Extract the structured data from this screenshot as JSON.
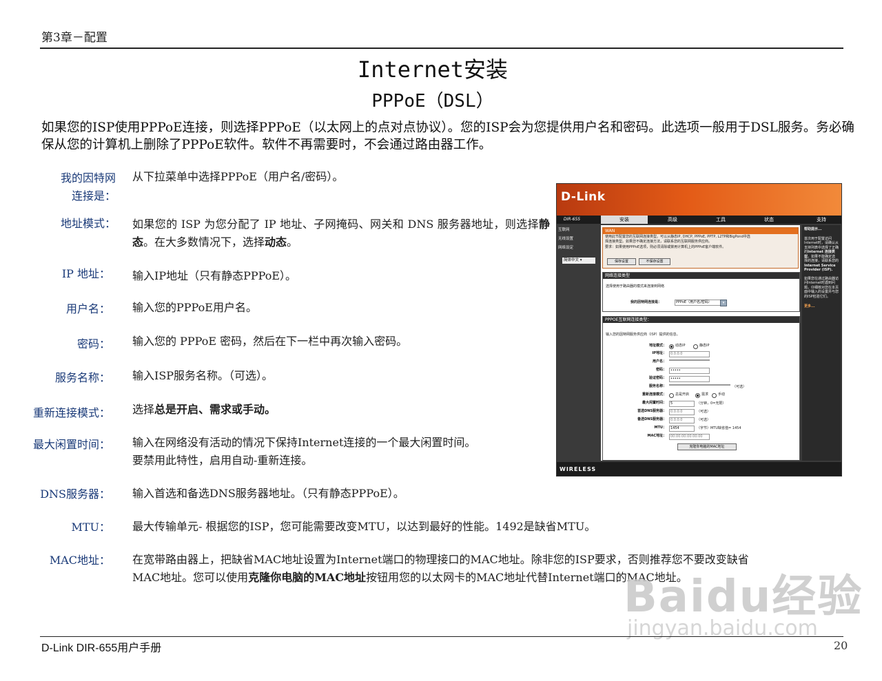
{
  "header": {
    "chapter": "第3章－配置"
  },
  "title": "Internet安装",
  "subtitle": "PPPoE（DSL）",
  "intro": "如果您的ISP使用PPPoE连接，则选择PPPoE（以太网上的点对点协议）。您的ISP会为您提供用户名和密码。此选项一般用于DSL服务。务必确保从您的计算机上删除了PPPoE软件。软件不再需要时，不会通过路由器工作。",
  "terms": {
    "conn_line1": "我的因特网",
    "conn_line2": "连接是：",
    "conn_desc": "从下拉菜单中选择PPPoE（用户名/密码）。",
    "addr": "地址模式：",
    "addr_desc_a": "如果您的 ISP 为您分配了 IP 地址、子网掩码、网关和 DNS 服务器地址，则选择",
    "addr_desc_b": "静态",
    "addr_desc_c": "。在大多数情况下，选择",
    "addr_desc_d": "动态",
    "addr_desc_e": "。",
    "ip": "IP 地址：",
    "ip_desc": "输入IP地址（只有静态PPPoE）。",
    "user": "用户名：",
    "user_desc": "输入您的PPPoE用户名。",
    "pass": "密码：",
    "pass_desc": "输入您的 PPPoE 密码，然后在下一栏中再次输入密码。",
    "service": "服务名称：",
    "service_desc": "输入ISP服务名称。（可选）。",
    "reconnect": "重新连接模式：",
    "reconnect_desc_a": "选择",
    "reconnect_desc_b": "总是开启、需求或手动。",
    "idle": "最大闲置时间：",
    "idle_desc_1": "输入在网络没有活动的情况下保持Internet连接的一个最大闲置时间。",
    "idle_desc_2": "要禁用此特性，启用自动-重新连接。",
    "dns": "DNS服务器：",
    "dns_desc": "输入首选和备选DNS服务器地址。（只有静态PPPoE）。",
    "mtu": "MTU：",
    "mtu_desc": "最大传输单元- 根据您的ISP，您可能需要改变MTU，以达到最好的性能。1492是缺省MTU。",
    "mac": "MAC地址：",
    "mac_desc_1": "在宽带路由器上，把缺省MAC地址设置为Internet端口的物理接口的MAC地址。除非您的ISP要求，否则推荐您不要改变缺省",
    "mac_desc_2a": "MAC地址。您可以使用",
    "mac_desc_2b": "克隆你电脑的MAC地址",
    "mac_desc_2c": "按钮用您的以太网卡的MAC地址代替Internet端口的MAC地址。"
  },
  "screenshot": {
    "logo": "D-Link",
    "model": "DIR-655",
    "tabs": [
      "安装",
      "高级",
      "工具",
      "状态",
      "支持"
    ],
    "sidebar": [
      "互联网",
      "无线设置",
      "网络设定"
    ],
    "language": "简体中文",
    "wan_title": "WAN",
    "wan_text_1": "使用此节配置您的互联网连接类型。可以从静态IP, DHCP, PPPoE, PPTP, L2TP和BigPond中选",
    "wan_text_2": "择连接类型。如果您不确定连接方法，请联系您的互联网服务供应商。",
    "wan_text_3": "要求：如果使用PPPoE选项，则必须清除或禁用计算机上的PPPoE客户端软件。",
    "save_btn": "保存设置",
    "nosave_btn": "不保存设置",
    "conn_type_title": "网络连接类型",
    "conn_type_prompt": "选择使用于路由器的模式来连接到网络",
    "conn_type_label": "我的因特网连接是：",
    "conn_type_value": "PPPoE（用户名/密码）",
    "pppoe_title": "PPPOE互联网连接类型：",
    "pppoe_prompt": "输入您的因特网服务供应商（ISP）提供的信息。",
    "labels": {
      "addr_mode": "地址模式：",
      "ip": "IP地址：",
      "user": "用户名：",
      "pass": "密码：",
      "verify": "验证密码：",
      "service": "服务名称：",
      "reconnect": "重新连接模式：",
      "idle": "最大闲置时间：",
      "dns1": "首选DNS服务器：",
      "dns2": "备选DNS服务器：",
      "mtu": "MTU：",
      "mac": "MAC地址："
    },
    "opt_dynamic": "动态IP",
    "opt_static": "静态IP",
    "opt_always": "总是开启",
    "opt_demand": "需求",
    "opt_manual": "手动",
    "ip_value": "0.0.0.0",
    "pass_value": "•••••",
    "verify_value": "•••••",
    "optional": "（可选）",
    "idle_value": "5",
    "idle_unit": "（分钟，0=无限）",
    "dns1_value": "0.0.0.0",
    "dns2_value": "0.0.0.0",
    "mtu_value": "1454",
    "mtu_unit": "（字节）MTU缺省值= 1454",
    "mac_value": "00:00:00:00:00:00",
    "clone_btn": "克隆你电脑的MAC地址",
    "hints_title": "帮助提示...",
    "hints_1": "首次用于配置访问Internet时，请确认从支持列表中选择了正确的",
    "hints_2": "Internet 连接类型",
    "hints_3": "。如果不能确定选择的连接，请联系您的",
    "hints_4": "Internet Service Provider (ISP).",
    "hints_5": "如果您在通过路由器访问Internet时遇到问题，仔细核对您在本页面中输入的设置并与您的ISP检验它们。",
    "hints_more": "更多...",
    "footer": "WIRELESS"
  },
  "footer": {
    "manual": "D-Link DIR-655用户手册",
    "page": "20"
  },
  "watermark": {
    "main": "Baidu经验",
    "sub": "jingyan.baidu.com"
  }
}
